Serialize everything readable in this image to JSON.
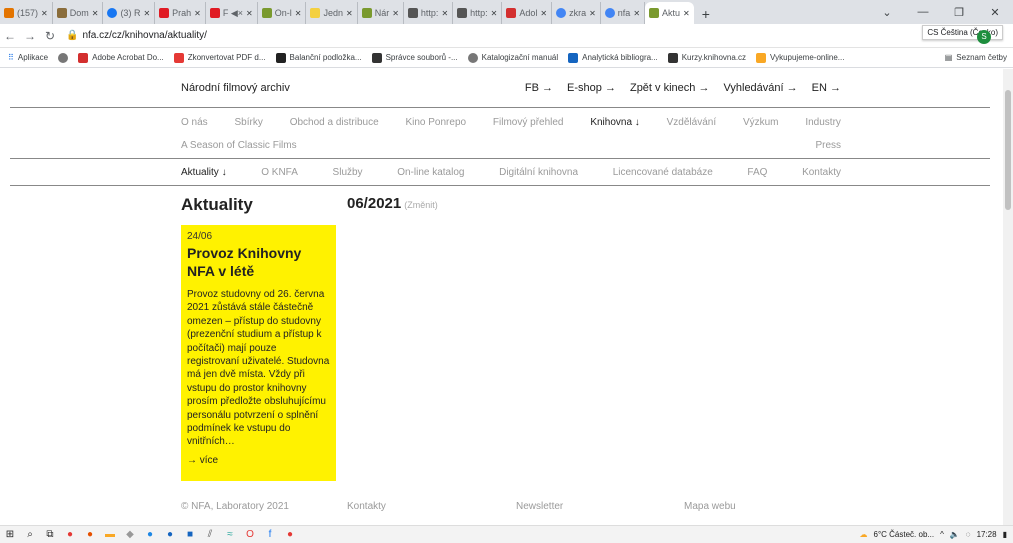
{
  "browser": {
    "tabs": [
      "(157)",
      "Dom",
      "(3) R",
      "Prah",
      "F ◀×",
      "On-l",
      "Jedn",
      "Nár",
      "http:",
      "http:",
      "Adol",
      "zkra",
      "nfa",
      "Aktu"
    ],
    "url": "nfa.cz/cz/knihovna/aktuality/",
    "lang_popup": "CS Čeština (Česko)",
    "profile": "S",
    "bookmarks": [
      "Aplikace",
      "Adobe Acrobat Do...",
      "Zkonvertovat PDF d...",
      "Balanční podložka...",
      "Správce souborů -...",
      "Katalogizační manuál",
      "Analytická bibliogra...",
      "Kurzy.knihovna.cz",
      "Vykupujeme-online..."
    ],
    "bookmarks_right": "Seznam četby"
  },
  "header": {
    "brand": "Národní filmový archiv",
    "links": [
      "FB →",
      "E-shop →",
      "Zpět v kinech →",
      "Vyhledávání →",
      "EN →"
    ]
  },
  "main_menu": [
    "O nás",
    "Sbírky",
    "Obchod a distribuce",
    "Kino Ponrepo",
    "Filmový přehled",
    "Knihovna ↓",
    "Vzdělávání",
    "Výzkum",
    "Industry"
  ],
  "main_menu_row2": {
    "left": "A Season of Classic Films",
    "right": "Press"
  },
  "sub_menu": [
    "Aktuality ↓",
    "O KNFA",
    "Služby",
    "On-line katalog",
    "Digitální knihovna",
    "Licencované databáze",
    "FAQ",
    "Kontakty"
  ],
  "content": {
    "title": "Aktuality",
    "month": "06/2021",
    "change": "(Změnit)",
    "card": {
      "date": "24/06",
      "headline": "Provoz Knihovny NFA v létě",
      "body": "Provoz studovny od 26. června 2021 zůstává stále částečně omezen – přístup do studovny (prezenční studium a přístup k počítači) mají pouze registrovaní uživatelé. Studovna má jen dvě místa. Vždy při vstupu do prostor knihovny prosím předložte obsluhujícímu personálu potvrzení o splnění podmínek ke vstupu do vnitřních…",
      "more": "→ více"
    }
  },
  "footer": {
    "copyright": "© NFA, Laboratory 2021",
    "contacts": "Kontakty",
    "newsletter": "Newsletter",
    "sitemap": "Mapa webu"
  },
  "taskbar": {
    "weather": "6°C Částeč. ob...",
    "time": "17:28"
  }
}
